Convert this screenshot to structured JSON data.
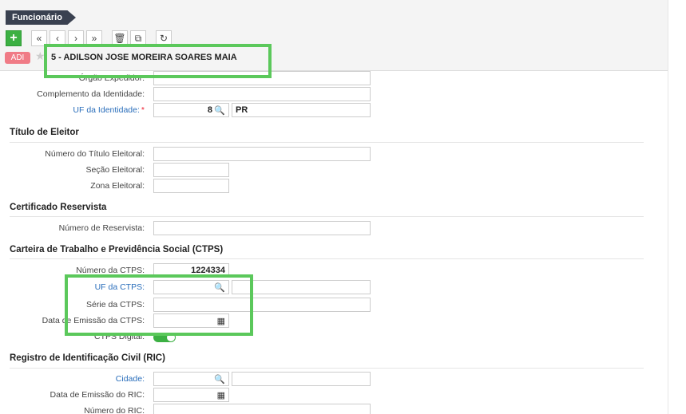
{
  "header": {
    "title": "Funcionário",
    "badge": "ADI",
    "employee_name": "5 - ADILSON JOSE MOREIRA SOARES MAIA",
    "toolbar": {
      "add": "+",
      "first": "«",
      "prev": "‹",
      "next": "›",
      "last": "»",
      "delete": "🗑",
      "copy": "⧉",
      "refresh": "↻"
    }
  },
  "identity": {
    "orgao_label": "Órgão Expedidor:",
    "complemento_label": "Complemento da Identidade:",
    "uf_label": "UF da Identidade:",
    "uf_code": "8",
    "uf_value": "PR"
  },
  "titulo": {
    "section": "Título de Eleitor",
    "numero_label": "Número do Título Eleitoral:",
    "secao_label": "Seção Eleitoral:",
    "zona_label": "Zona Eleitoral:"
  },
  "reservista": {
    "section": "Certificado Reservista",
    "numero_label": "Número de Reservista:"
  },
  "ctps": {
    "section": "Carteira de Trabalho e Previdência Social (CTPS)",
    "numero_label": "Número da CTPS:",
    "numero_value": "1224334",
    "uf_label": "UF da CTPS:",
    "serie_label": "Série da CTPS:",
    "emissao_label": "Data de Emissão da CTPS:",
    "digital_label": "CTPS Digital:"
  },
  "ric": {
    "section": "Registro de Identificação Civil (RIC)",
    "cidade_label": "Cidade:",
    "emissao_label": "Data de Emissão do RIC:",
    "numero_label": "Número do RIC:"
  },
  "icons": {
    "search": "🔍",
    "calendar": "▦"
  },
  "colors": {
    "highlight": "#5bc85b",
    "add_button": "#3cb043",
    "badge": "#f07b86",
    "link": "#2a6ebb"
  }
}
